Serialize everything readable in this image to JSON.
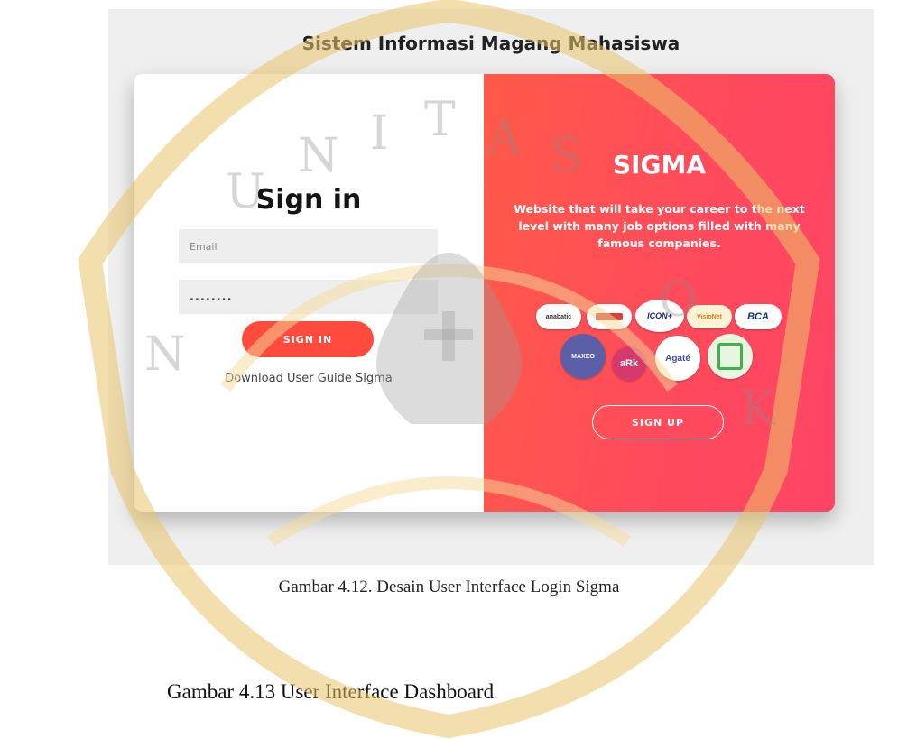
{
  "app_title": "Sistem Informasi Magang Mahasiswa",
  "left_panel": {
    "heading": "Sign in",
    "email_placeholder": "Email",
    "password_value": "........",
    "signin_button": "SIGN IN",
    "guide_link": "Download User Guide Sigma"
  },
  "right_panel": {
    "brand": "SIGMA",
    "tagline": "Website that will take your career to the next level with many job options filled with many famous companies.",
    "signup_button": "SIGN UP",
    "partner_logos": [
      {
        "name": "anabatic",
        "label": "anabatic"
      },
      {
        "name": "banner",
        "label": ""
      },
      {
        "name": "icon",
        "label": "ICON+"
      },
      {
        "name": "visionet",
        "label": "VisioNet"
      },
      {
        "name": "bca",
        "label": "BCA"
      },
      {
        "name": "maxeo",
        "label": "MAXEO"
      },
      {
        "name": "ark",
        "label": "aRk"
      },
      {
        "name": "agate",
        "label": "Agaté"
      },
      {
        "name": "green",
        "label": ""
      }
    ]
  },
  "colors": {
    "accent": "#ff4b3e",
    "panel_gradient_start": "#ff5a48",
    "panel_gradient_end": "#ff4464"
  },
  "document": {
    "caption": "Gambar 4.12. Desain User Interface Login Sigma",
    "next_heading": "Gambar 4.13 User Interface Dashboard"
  }
}
